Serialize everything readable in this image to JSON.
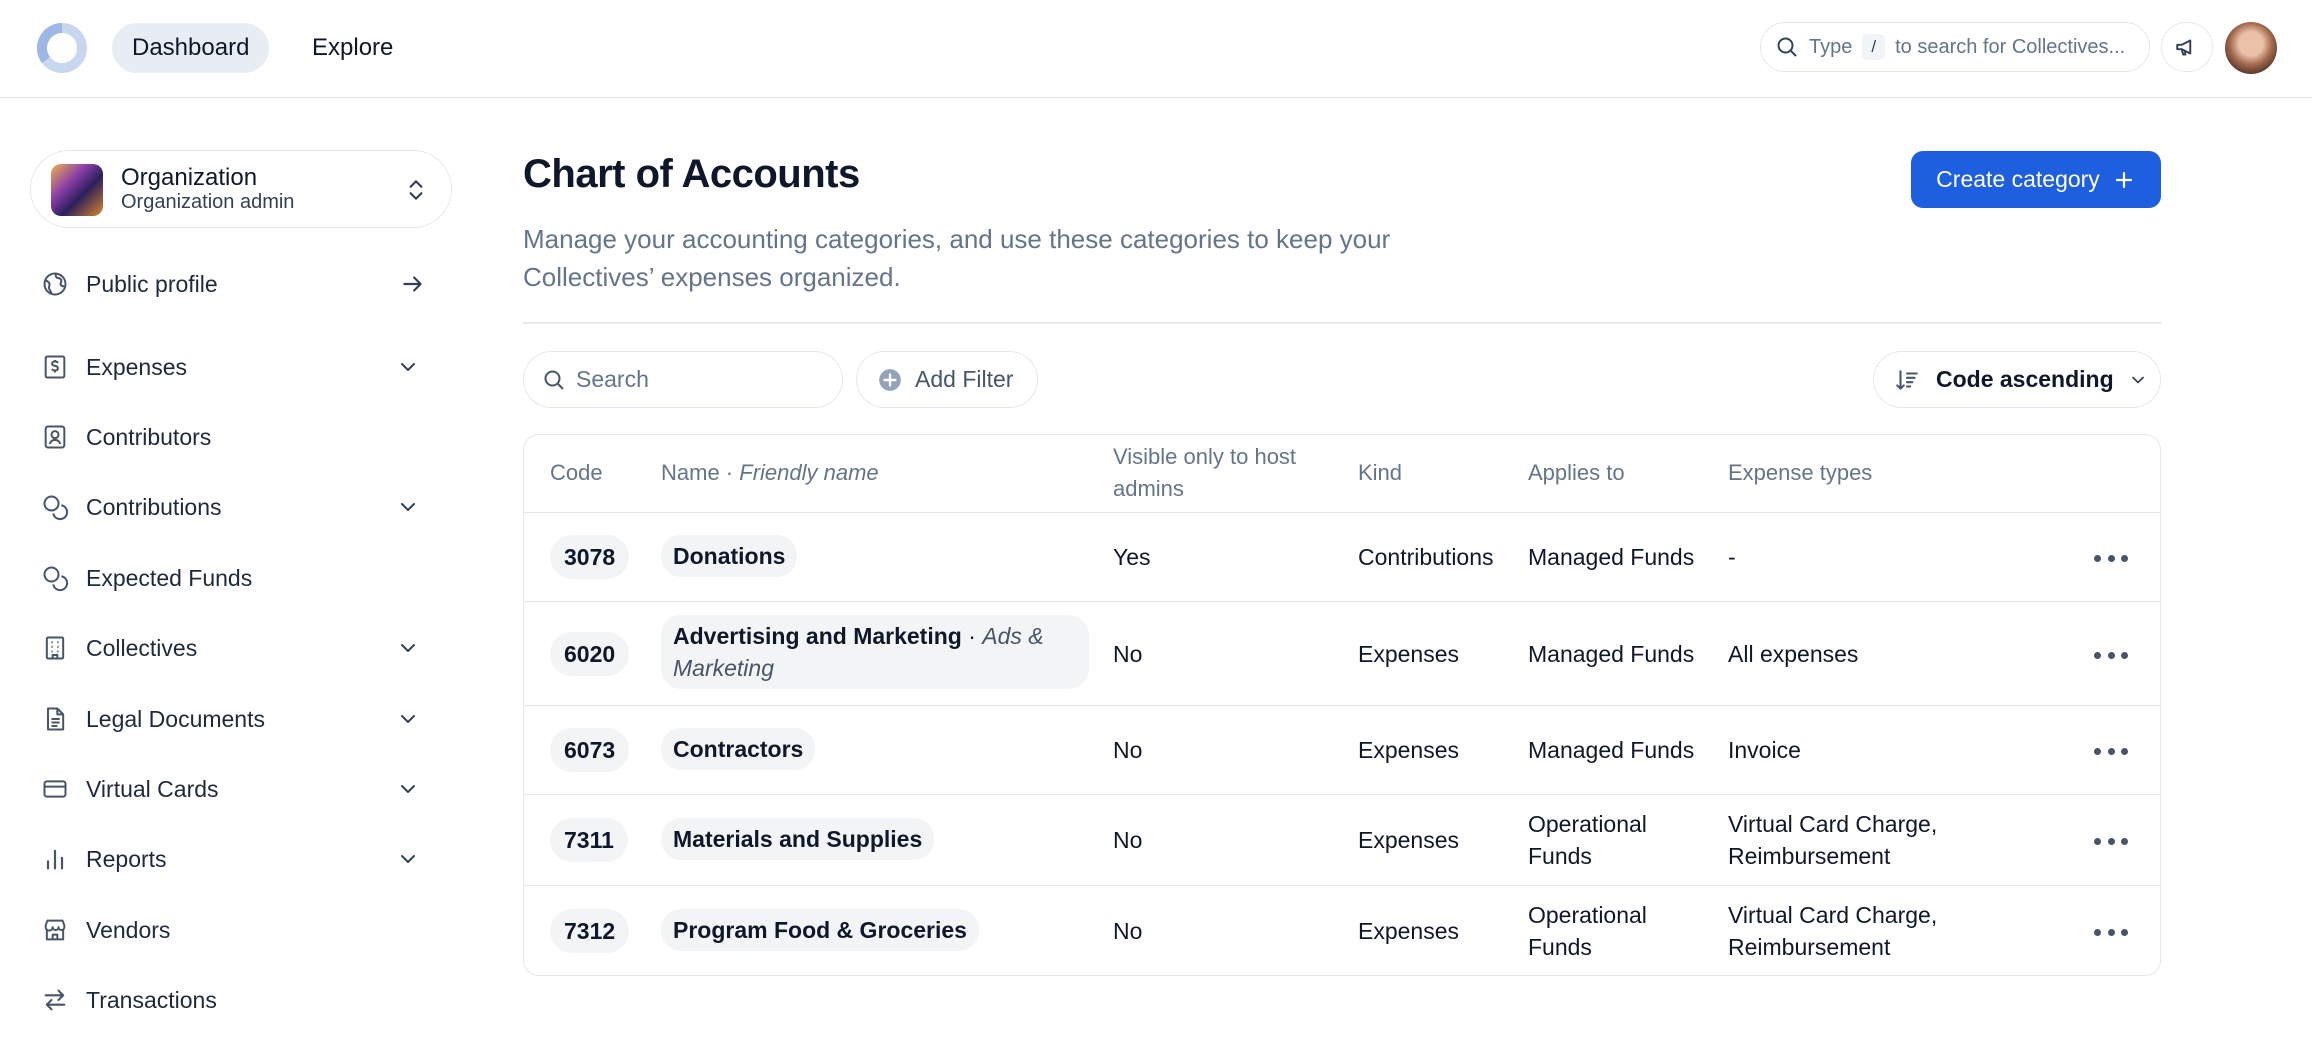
{
  "topbar": {
    "nav": [
      "Dashboard",
      "Explore"
    ],
    "search_prefix": "Type",
    "search_key": "/",
    "search_suffix": "to search for Collectives..."
  },
  "sidebar": {
    "org_name": "Organization",
    "org_role": "Organization admin",
    "items": [
      {
        "label": "Public profile",
        "icon": "globe-icon",
        "trailing": "arrow-right"
      },
      {
        "label": "Expenses",
        "icon": "receipt-icon",
        "trailing": "chevron"
      },
      {
        "label": "Contributors",
        "icon": "contact-icon",
        "trailing": ""
      },
      {
        "label": "Contributions",
        "icon": "coins-icon",
        "trailing": "chevron"
      },
      {
        "label": "Expected Funds",
        "icon": "coins-icon",
        "trailing": ""
      },
      {
        "label": "Collectives",
        "icon": "building-icon",
        "trailing": "chevron"
      },
      {
        "label": "Legal Documents",
        "icon": "document-icon",
        "trailing": "chevron"
      },
      {
        "label": "Virtual Cards",
        "icon": "card-icon",
        "trailing": "chevron"
      },
      {
        "label": "Reports",
        "icon": "bar-chart-icon",
        "trailing": "chevron"
      },
      {
        "label": "Vendors",
        "icon": "store-icon",
        "trailing": ""
      },
      {
        "label": "Transactions",
        "icon": "arrows-icon",
        "trailing": ""
      }
    ]
  },
  "main": {
    "title": "Chart of Accounts",
    "description": "Manage your accounting categories, and use these categories to keep your Collectives’ expenses organized.",
    "create_label": "Create category",
    "search_placeholder": "Search",
    "filter_label": "Add Filter",
    "sort_label": "Code ascending"
  },
  "table": {
    "headers": {
      "code": "Code",
      "name": "Name · ",
      "friendly": "Friendly name",
      "visible": "Visible only to host admins",
      "kind": "Kind",
      "applies": "Applies to",
      "types": "Expense types"
    },
    "rows": [
      {
        "code": "3078",
        "name": "Donations",
        "friendly": "",
        "visible": "Yes",
        "kind": "Contributions",
        "applies": "Managed Funds",
        "types": "-"
      },
      {
        "code": "6020",
        "name": "Advertising and Marketing",
        "friendly": "Ads & Marketing",
        "visible": "No",
        "kind": "Expenses",
        "applies": "Managed Funds",
        "types": "All expenses"
      },
      {
        "code": "6073",
        "name": "Contractors",
        "friendly": "",
        "visible": "No",
        "kind": "Expenses",
        "applies": "Managed Funds",
        "types": "Invoice"
      },
      {
        "code": "7311",
        "name": "Materials and Supplies",
        "friendly": "",
        "visible": "No",
        "kind": "Expenses",
        "applies": "Operational Funds",
        "types": "Virtual Card Charge, Reimbursement"
      },
      {
        "code": "7312",
        "name": "Program Food & Groceries",
        "friendly": "",
        "visible": "No",
        "kind": "Expenses",
        "applies": "Operational Funds",
        "types": "Virtual Card Charge, Reimbursement"
      }
    ]
  },
  "colors": {
    "primary": "#1e5fe0",
    "muted": "#64748b",
    "border": "#e2e8f0"
  }
}
